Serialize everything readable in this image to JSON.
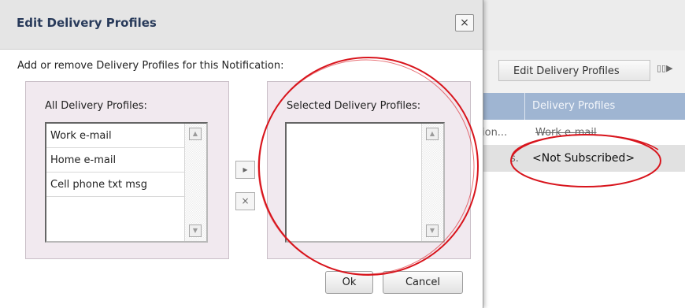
{
  "background_app": {
    "toolbar": {
      "edit_label": "Edit Delivery Profiles",
      "columns_icon_label": "▯▯▶"
    },
    "table": {
      "header": "Delivery Profiles",
      "rows": [
        {
          "left": "ion...",
          "value": "Work e-mail"
        },
        {
          "left": "s.",
          "value": "<Not Subscribed>"
        }
      ]
    }
  },
  "dialog": {
    "title": "Edit Delivery Profiles",
    "close_glyph": "×",
    "instruction": "Add or remove Delivery Profiles for this Notification:",
    "all_profiles": {
      "label": "All Delivery Profiles:",
      "items": [
        "Work e-mail",
        "Home e-mail",
        "Cell phone txt msg"
      ]
    },
    "selected_profiles": {
      "label": "Selected Delivery Profiles:",
      "items": []
    },
    "move_right_glyph": "▸",
    "move_left_glyph": "×",
    "ok_label": "Ok",
    "cancel_label": "Cancel"
  },
  "annotations": {
    "highlight_color": "#d8141c"
  }
}
